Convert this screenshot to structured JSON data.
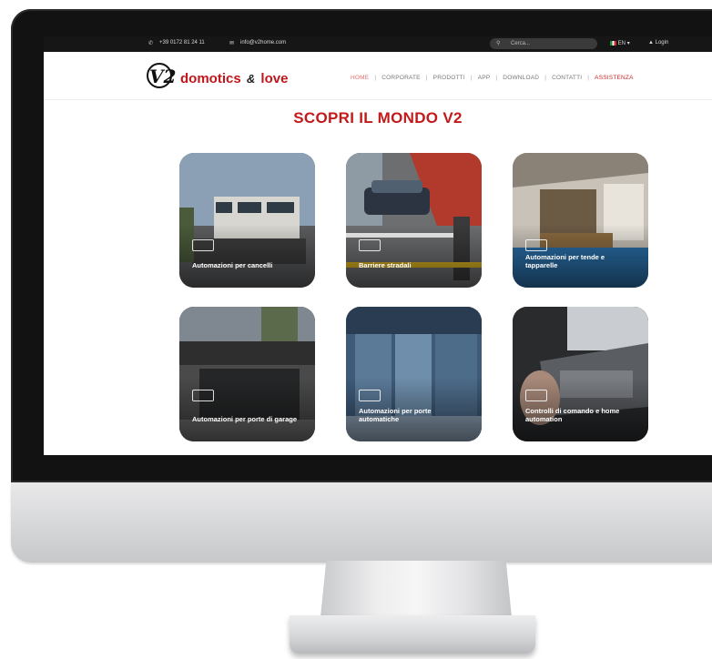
{
  "topbar": {
    "phone_icon": "phone-icon",
    "phone": "+39 0172 81 24 11",
    "mail_icon": "mail-icon",
    "email": "info@v2home.com",
    "search_placeholder": "Cerca...",
    "language": "EN",
    "login": "Login"
  },
  "header": {
    "logo_mark": "V2",
    "logo_word1": "domotics",
    "logo_amp": "&",
    "logo_word2": "love",
    "nav": [
      "HOME",
      "CORPORATE",
      "PRODOTTI",
      "APP",
      "DOWNLOAD",
      "CONTATTI",
      "ASSISTENZA"
    ],
    "nav_separator": "|"
  },
  "main": {
    "title": "SCOPRI IL MONDO V2",
    "tiles": [
      {
        "label": "Automazioni per cancelli"
      },
      {
        "label": "Barriere stradali"
      },
      {
        "label": "Automazioni per tende e tapparelle"
      },
      {
        "label": "Automazioni per porte di garage"
      },
      {
        "label": "Automazioni per porte automatiche"
      },
      {
        "label": "Controlli di comando e home automation"
      }
    ]
  },
  "colors": {
    "brand_red": "#c21a1a",
    "topbar_bg": "#161616",
    "nav_active": "#e46c6c"
  }
}
